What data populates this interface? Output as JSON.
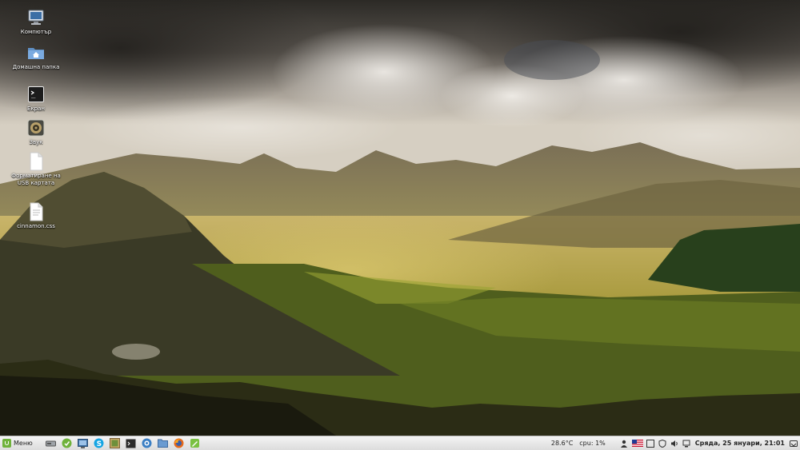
{
  "desktop": {
    "icons": [
      {
        "label": "Компютър",
        "icon": "computer-icon"
      },
      {
        "label": "Домашна папка",
        "icon": "home-folder-icon"
      },
      {
        "label": "Екран",
        "icon": "terminal-icon"
      },
      {
        "label": "Звук",
        "icon": "speaker-icon"
      },
      {
        "label": "Форматиране на USB картата",
        "icon": "document-icon"
      },
      {
        "label": "cinnamon.css",
        "icon": "document-icon"
      }
    ]
  },
  "panel": {
    "menu_label": "Меню",
    "launchers": [
      "drive-icon",
      "mint-update-icon",
      "screenshot-icon",
      "skype-icon",
      "image-viewer-icon",
      "terminal-launcher-icon",
      "network-icon",
      "folder-icon",
      "firefox-icon",
      "text-editor-icon"
    ],
    "temperature": "28.6°C",
    "cpu": "cpu: 1%",
    "clock": "Сряда, 25 януари, 21:01",
    "tray_icons": [
      "user-icon",
      "flag-us-icon",
      "window-icon",
      "shield-icon",
      "volume-icon",
      "network-tray-icon",
      "show-desktop-icon"
    ]
  },
  "colors": {
    "panel_bg": "#e6e6e6",
    "mint_green": "#6fb23b"
  }
}
